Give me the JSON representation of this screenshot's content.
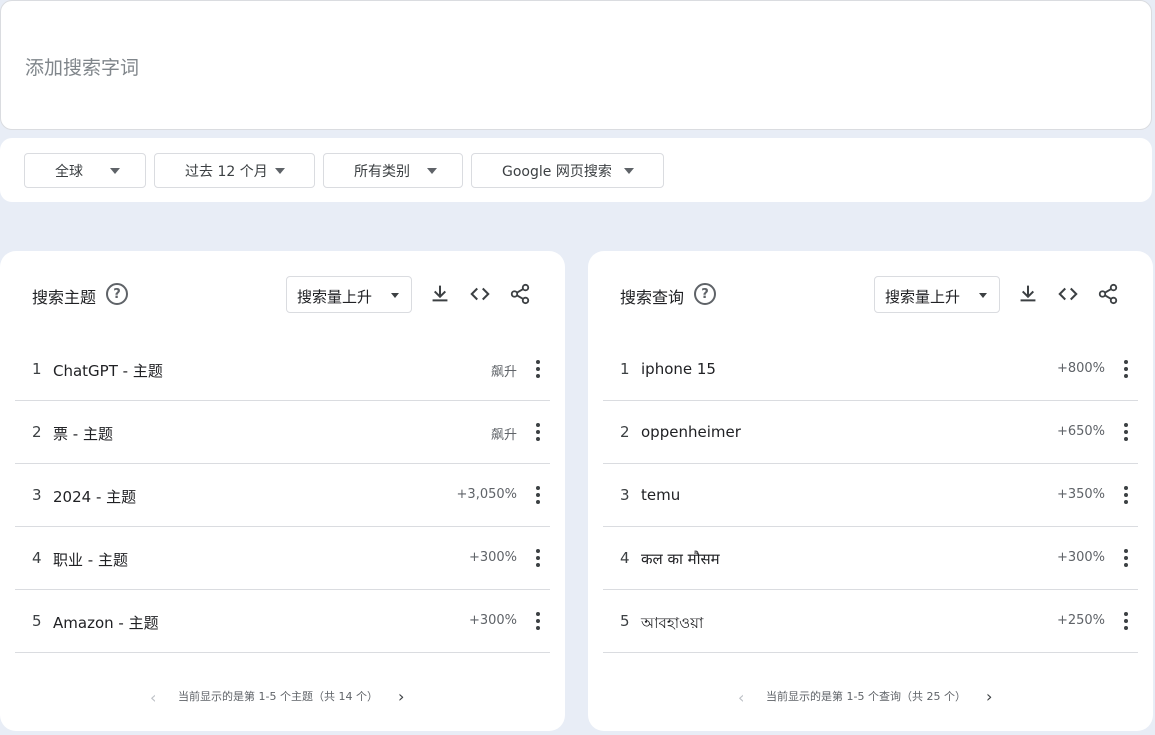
{
  "search": {
    "placeholder": "添加搜索字词"
  },
  "filters": [
    {
      "label": "全球"
    },
    {
      "label": "过去 12 个月"
    },
    {
      "label": "所有类别"
    },
    {
      "label": "Google 网页搜索"
    }
  ],
  "topics": {
    "title": "搜索主题",
    "sort_label": "搜索量上升",
    "rows": [
      {
        "rank": "1",
        "term": "ChatGPT - 主题",
        "value": "飙升"
      },
      {
        "rank": "2",
        "term": "票 - 主题",
        "value": "飙升"
      },
      {
        "rank": "3",
        "term": "2024 - 主题",
        "value": "+3,050%"
      },
      {
        "rank": "4",
        "term": "职业 - 主题",
        "value": "+300%"
      },
      {
        "rank": "5",
        "term": "Amazon - 主题",
        "value": "+300%"
      }
    ],
    "pager": "当前显示的是第 1-5 个主题（共 14 个）"
  },
  "queries": {
    "title": "搜索查询",
    "sort_label": "搜索量上升",
    "rows": [
      {
        "rank": "1",
        "term": "iphone 15",
        "value": "+800%"
      },
      {
        "rank": "2",
        "term": "oppenheimer",
        "value": "+650%"
      },
      {
        "rank": "3",
        "term": "temu",
        "value": "+350%"
      },
      {
        "rank": "4",
        "term": "कल का मौसम",
        "value": "+300%"
      },
      {
        "rank": "5",
        "term": "আবহাওয়া",
        "value": "+250%"
      }
    ],
    "pager": "当前显示的是第 1-5 个查询（共 25 个）"
  },
  "icons": {
    "help": "question-mark-icon",
    "download": "download-icon",
    "embed": "code-embed-icon",
    "share": "share-icon",
    "more": "more-vert-icon",
    "prev": "chevron-left-icon",
    "next": "chevron-right-icon"
  },
  "colors": {
    "background": "#e8edf6",
    "card": "#ffffff",
    "text": "#202124",
    "muted": "#5f6368"
  }
}
